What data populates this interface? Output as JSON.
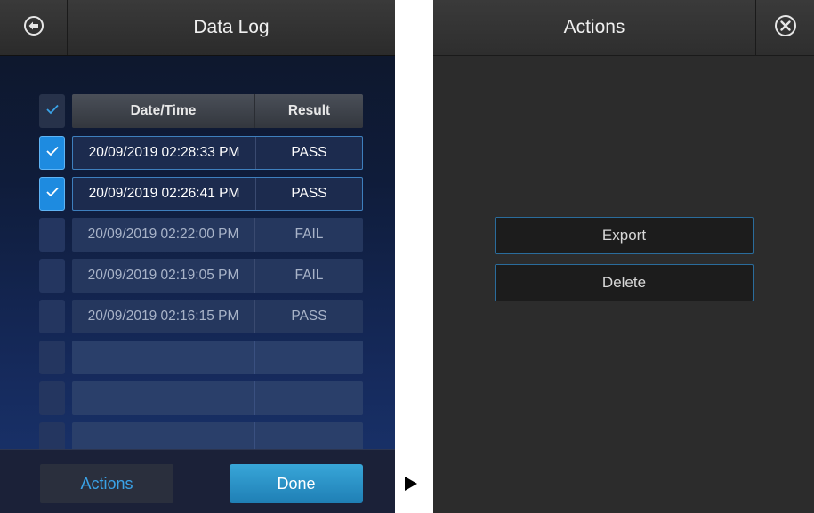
{
  "data_log": {
    "title": "Data Log",
    "back_icon": "back-arrow-icon",
    "columns": {
      "datetime": "Date/Time",
      "result": "Result"
    },
    "header_checkbox_checked": true,
    "rows": [
      {
        "datetime": "20/09/2019 02:28:33 PM",
        "result": "PASS",
        "checked": true
      },
      {
        "datetime": "20/09/2019 02:26:41 PM",
        "result": "PASS",
        "checked": true
      },
      {
        "datetime": "20/09/2019 02:22:00 PM",
        "result": "FAIL",
        "checked": false
      },
      {
        "datetime": "20/09/2019 02:19:05 PM",
        "result": "FAIL",
        "checked": false
      },
      {
        "datetime": "20/09/2019 02:16:15 PM",
        "result": "PASS",
        "checked": false
      },
      {
        "datetime": "",
        "result": "",
        "checked": false
      },
      {
        "datetime": "",
        "result": "",
        "checked": false
      },
      {
        "datetime": "",
        "result": "",
        "checked": false
      }
    ],
    "footer": {
      "actions_label": "Actions",
      "done_label": "Done"
    }
  },
  "actions_panel": {
    "title": "Actions",
    "close_icon": "close-circle-icon",
    "buttons": {
      "export_label": "Export",
      "delete_label": "Delete"
    }
  },
  "colors": {
    "accent_blue": "#1e8be0",
    "done_button": "#2a93c8",
    "actions_text": "#3aa3e8",
    "panel_dark": "#2c2c2c"
  }
}
